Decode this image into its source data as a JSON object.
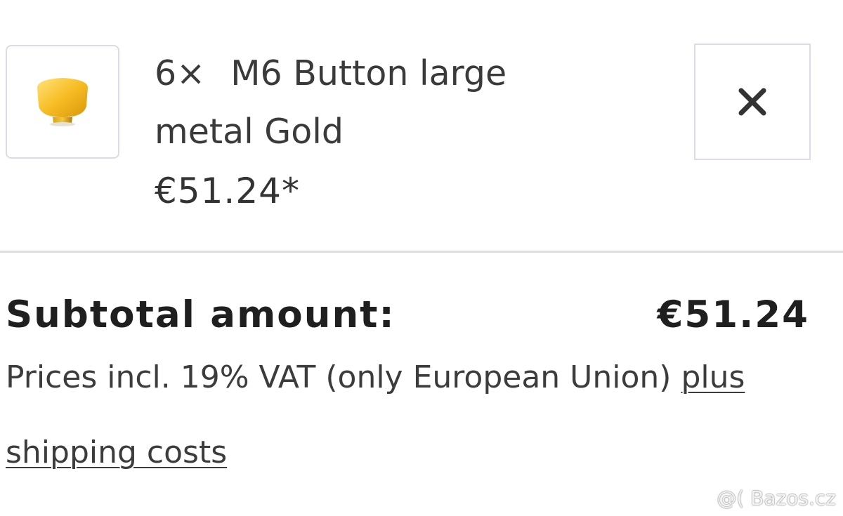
{
  "cart_item": {
    "quantity": "6×",
    "name_line1": "M6 Button large",
    "name_line2": "metal Gold",
    "price": "€51.24*"
  },
  "remove_icon": "close-icon",
  "summary": {
    "subtotal_label": "Subtotal amount:",
    "subtotal_value": "€51.24",
    "vat_text": "Prices incl. 19% VAT (only European Union)",
    "plus_link": "plus",
    "shipping_link": "shipping costs"
  },
  "watermark": "@( Bazos.cz",
  "colors": {
    "border": "#dcdbe6",
    "gold": "#f2b51c",
    "text": "#2f2f2f"
  }
}
